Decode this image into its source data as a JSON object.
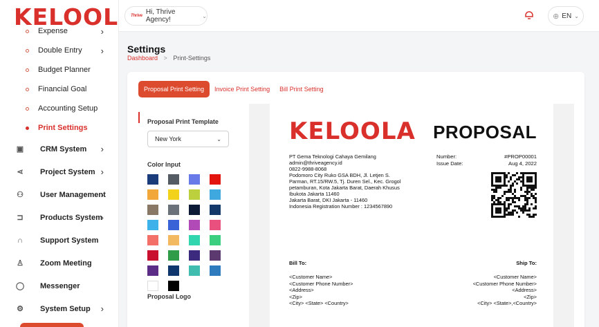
{
  "sidebar": {
    "logo": "KELOOLA",
    "sub_items": [
      {
        "label": "Expense",
        "chevron": "›"
      },
      {
        "label": "Double Entry",
        "chevron": "›"
      },
      {
        "label": "Budget Planner",
        "chevron": ""
      },
      {
        "label": "Financial Goal",
        "chevron": ""
      },
      {
        "label": "Accounting Setup",
        "chevron": ""
      },
      {
        "label": "Print Settings",
        "chevron": "",
        "active": true
      }
    ],
    "main_items": [
      {
        "label": "CRM System",
        "icon": "crm-icon",
        "chevron": "›"
      },
      {
        "label": "Project System",
        "icon": "project-icon",
        "chevron": "›"
      },
      {
        "label": "User Management",
        "icon": "users-icon",
        "chevron": "›"
      },
      {
        "label": "Products System",
        "icon": "cart-icon",
        "chevron": "›"
      },
      {
        "label": "Support System",
        "icon": "headset-icon",
        "chevron": ""
      },
      {
        "label": "Zoom Meeting",
        "icon": "zoom-icon",
        "chevron": ""
      },
      {
        "label": "Messenger",
        "icon": "chat-icon",
        "chevron": ""
      },
      {
        "label": "System Setup",
        "icon": "gear-icon",
        "chevron": "›"
      }
    ]
  },
  "topbar": {
    "avatar_logo": "Thrive",
    "greeting": "Hi, Thrive Agency!",
    "language": "EN"
  },
  "page": {
    "title": "Settings",
    "breadcrumb_home": "Dashboard",
    "breadcrumb_current": "Print-Settings"
  },
  "tabs": [
    {
      "label": "Proposal Print Setting",
      "active": true
    },
    {
      "label": "Invoice Print Setting",
      "active": false
    },
    {
      "label": "Bill Print Setting",
      "active": false
    }
  ],
  "settings": {
    "template_label": "Proposal Print Template",
    "template_value": "New York",
    "color_label": "Color Input",
    "logo_label": "Proposal Logo",
    "colors": [
      "#1b3c7a",
      "#555b62",
      "#6879e8",
      "#e3140e",
      "#f2a73b",
      "#f3d21b",
      "#bcd03e",
      "#3fa8df",
      "#8a7866",
      "#6c7279",
      "#0c1a36",
      "#15386b",
      "#3db1ea",
      "#3b63d8",
      "#b14ab7",
      "#e9507e",
      "#f27067",
      "#f3b960",
      "#32d6ae",
      "#3ccf7f",
      "#c9102f",
      "#2e9c48",
      "#3b2a7e",
      "#5c3a70",
      "#5b2d86",
      "#10366e",
      "#41bdb0",
      "#2e7bbd",
      "#ffffff",
      "#000000"
    ]
  },
  "preview": {
    "logo": "KELOOLA",
    "title": "PROPOSAL",
    "company_lines": [
      "PT Gema Teknologi Cahaya Gemilang",
      "admin@thriveagency.id",
      "0822-9988-8068",
      "Podomoro City Ruko GSA BDH, Jl. Letjen S.",
      "Parman, RT.15/RW.5, Tj. Duren Sel., Kec. Grogol",
      "petamburan, Kota Jakarta Barat, Daerah Khusus",
      "Ibukota Jakarta 11460",
      "Jakarta Barat, DKI Jakarta - 11460",
      "Indonesia Registration Number : 1234567890"
    ],
    "number_label": "Number:",
    "number_value": "#PROP00001",
    "issue_label": "Issue Date:",
    "issue_value": "Aug 4, 2022",
    "bill_to": "Bill To:",
    "ship_to": "Ship To:",
    "bill_lines": [
      "<Customer Name>",
      "<Customer Phone Number>",
      "<Address>",
      "<Zip>",
      "<City> <State> <Country>"
    ],
    "ship_lines": [
      "<Customer Name>",
      "<Customer Phone Number>",
      "<Address>",
      "<Zip>",
      "<City> <State>,<Country>"
    ]
  },
  "accent_color": "#d9302c"
}
